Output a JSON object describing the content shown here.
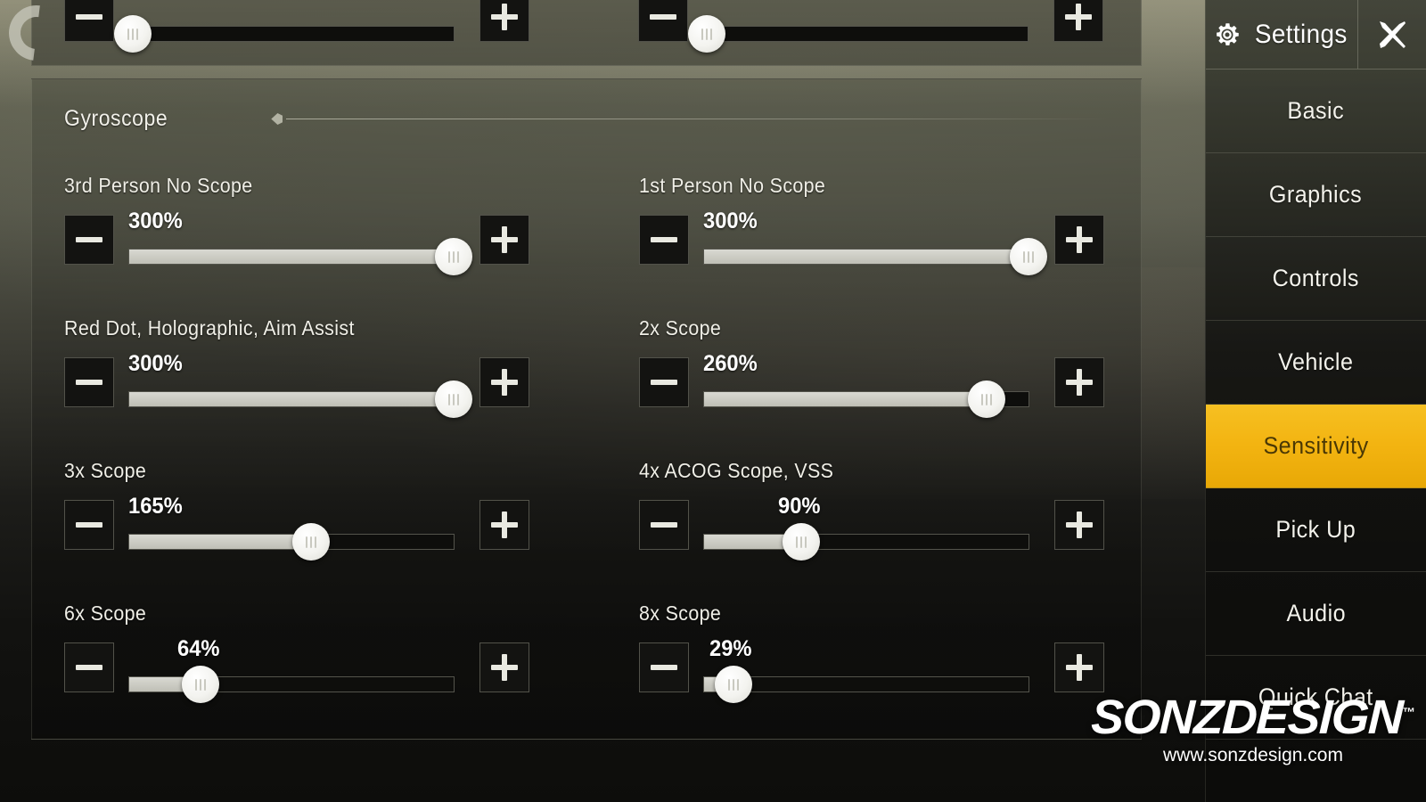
{
  "section": {
    "title": "Gyroscope"
  },
  "sliders": [
    {
      "label": "3rd Person No Scope",
      "value": "300%",
      "percent": 100
    },
    {
      "label": "1st Person No Scope",
      "value": "300%",
      "percent": 100
    },
    {
      "label": "Red Dot, Holographic, Aim Assist",
      "value": "300%",
      "percent": 100
    },
    {
      "label": "2x Scope",
      "value": "260%",
      "percent": 87
    },
    {
      "label": "3x Scope",
      "value": "165%",
      "percent": 56
    },
    {
      "label": "4x ACOG Scope, VSS",
      "value": "90%",
      "percent": 30
    },
    {
      "label": "6x Scope",
      "value": "64%",
      "percent": 22
    },
    {
      "label": "8x Scope",
      "value": "29%",
      "percent": 9
    }
  ],
  "controls": {
    "decrease_label": "−",
    "increase_label": "+"
  },
  "sidebar": {
    "title": "Settings",
    "gear_icon": "gear-icon",
    "close_icon": "close-x-icon",
    "items": [
      {
        "label": "Basic",
        "active": false
      },
      {
        "label": "Graphics",
        "active": false
      },
      {
        "label": "Controls",
        "active": false
      },
      {
        "label": "Vehicle",
        "active": false
      },
      {
        "label": "Sensitivity",
        "active": true
      },
      {
        "label": "Pick Up",
        "active": false
      },
      {
        "label": "Audio",
        "active": false
      },
      {
        "label": "Quick Chat",
        "active": false
      }
    ],
    "active_color": "#f3b411",
    "active_text_color": "#4a3805"
  },
  "watermark": {
    "brand": "SONZDESIGN",
    "tm": "™",
    "url": "www.sonzdesign.com"
  }
}
